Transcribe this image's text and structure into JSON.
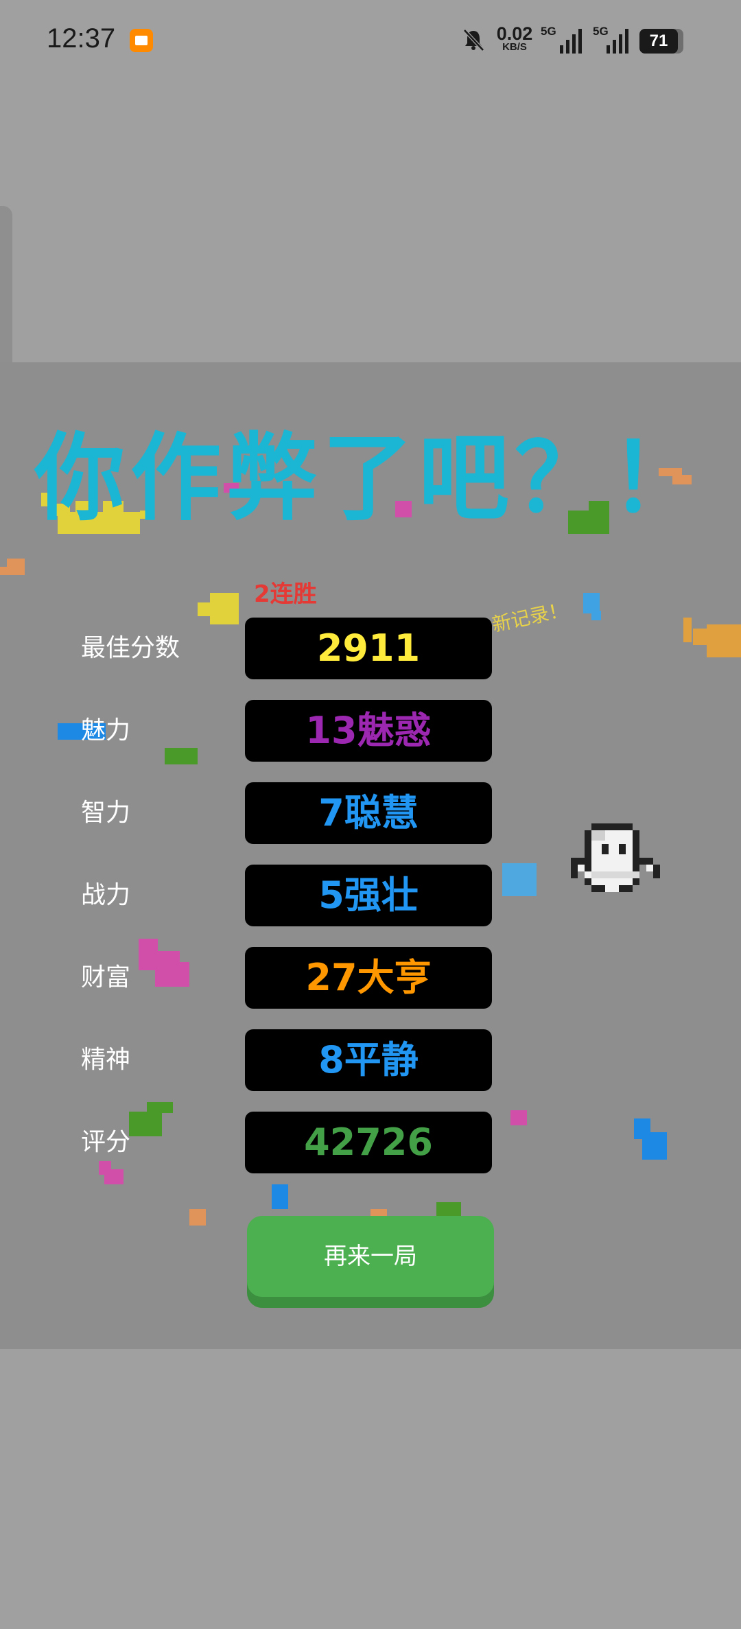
{
  "status": {
    "time": "12:37",
    "net_speed_value": "0.02",
    "net_speed_unit": "KB/S",
    "sim1_tag": "5G",
    "sim2_tag": "5G",
    "battery": "71"
  },
  "game": {
    "title": "你作弊了吧？！",
    "streak": "2连胜",
    "new_record": "新记录！",
    "stats": [
      {
        "label": "最佳分数",
        "value": "2911",
        "color": "#ffeb3b"
      },
      {
        "label": "魅力",
        "value": "13魅惑",
        "color": "#9c27b0"
      },
      {
        "label": "智力",
        "value": "7聪慧",
        "color": "#2196f3"
      },
      {
        "label": "战力",
        "value": "5强壮",
        "color": "#2196f3"
      },
      {
        "label": "财富",
        "value": "27大亨",
        "color": "#ff9800"
      },
      {
        "label": "精神",
        "value": "8平静",
        "color": "#2196f3"
      },
      {
        "label": "评分",
        "value": "42726",
        "color": "#43a047"
      }
    ],
    "play_again_label": "再来一局"
  },
  "colors": {
    "title": "#1ab6d4",
    "streak": "#e53935",
    "new_record": "#e8d24a",
    "button": "#4caf50"
  }
}
